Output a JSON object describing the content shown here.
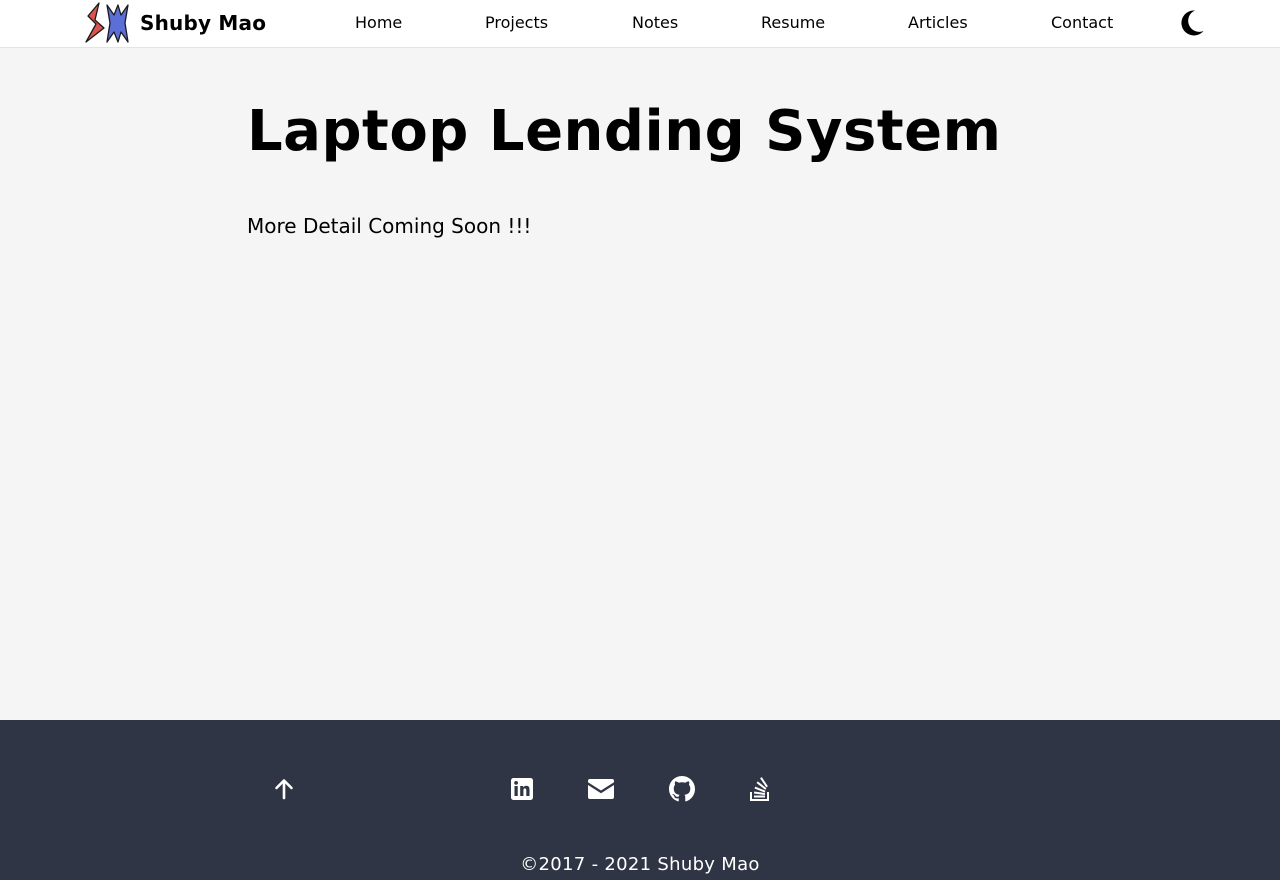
{
  "nav": {
    "brand_name": "Shuby Mao",
    "links": [
      {
        "label": "Home"
      },
      {
        "label": "Projects"
      },
      {
        "label": "Notes"
      },
      {
        "label": "Resume"
      },
      {
        "label": "Articles"
      },
      {
        "label": "Contact"
      }
    ],
    "theme_toggle_icon": "moon-icon"
  },
  "main": {
    "title": "Laptop Lending System",
    "body": "More Detail Coming Soon !!!"
  },
  "footer": {
    "icons": [
      "arrow-up-icon",
      "linkedin-icon",
      "envelope-icon",
      "github-icon",
      "stack-overflow-icon"
    ],
    "copyright": "©2017 - 2021 Shuby Mao"
  },
  "colors": {
    "page_background": "#f5f5f5",
    "navbar_background": "#ffffff",
    "footer_background": "#303545",
    "logo_red": "#d9534f",
    "logo_blue": "#5b6fd6"
  }
}
